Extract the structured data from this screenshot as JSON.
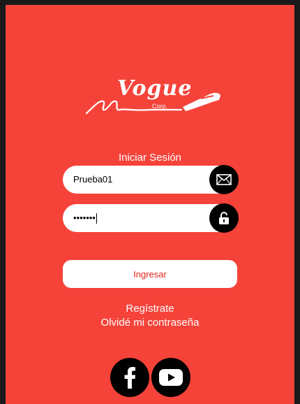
{
  "brand": {
    "logo_text": "Vogue",
    "logo_sub": "Corp."
  },
  "login": {
    "title": "Iniciar Sesión",
    "username_value": "Prueba01",
    "password_value": "•••••••",
    "submit_label": "Ingresar",
    "register_link": "Regístrate",
    "forgot_link": "Olvidé mi contraseña"
  },
  "icons": {
    "username": "mail-icon",
    "password": "lock-icon",
    "social_1": "facebook-icon",
    "social_2": "youtube-icon"
  },
  "colors": {
    "background": "#f5433a",
    "button_text": "#e3261d",
    "icon_bg": "#000000"
  }
}
